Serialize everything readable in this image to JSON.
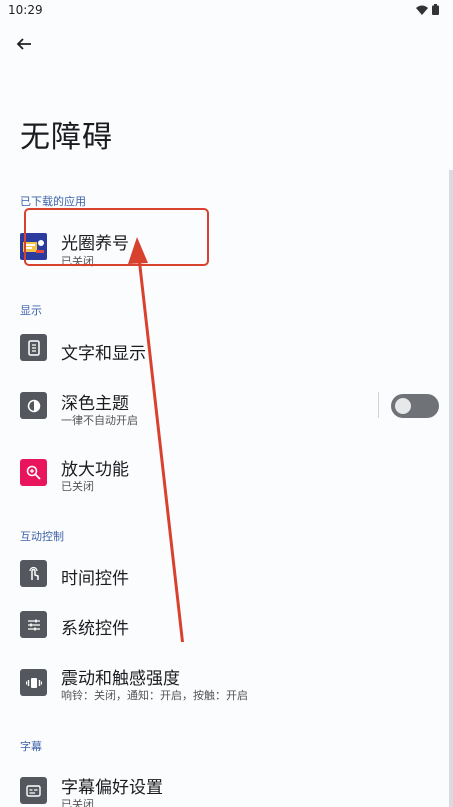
{
  "status_bar": {
    "time": "10:29"
  },
  "header": {
    "title": "无障碍"
  },
  "sections": {
    "downloaded": "已下载的应用",
    "display": "显示",
    "interaction": "互动控制",
    "captions": "字幕"
  },
  "items": {
    "app1": {
      "title": "光圈养号",
      "subtitle": "已关闭"
    },
    "text_display": {
      "title": "文字和显示"
    },
    "dark_theme": {
      "title": "深色主题",
      "subtitle": "一律不自动开启",
      "toggle": false
    },
    "magnify": {
      "title": "放大功能",
      "subtitle": "已关闭"
    },
    "timing": {
      "title": "时间控件"
    },
    "system_controls": {
      "title": "系统控件"
    },
    "vibration": {
      "title": "震动和触感强度",
      "subtitle": "响铃：关闭，通知：开启，按触：开启"
    },
    "caption_prefs": {
      "title": "字幕偏好设置",
      "subtitle": "已关闭"
    }
  },
  "colors": {
    "accent": "#3d62a8",
    "icon_gray": "#54585e",
    "magnify_pink": "#e8145c",
    "annotation_red": "#d9412f"
  }
}
